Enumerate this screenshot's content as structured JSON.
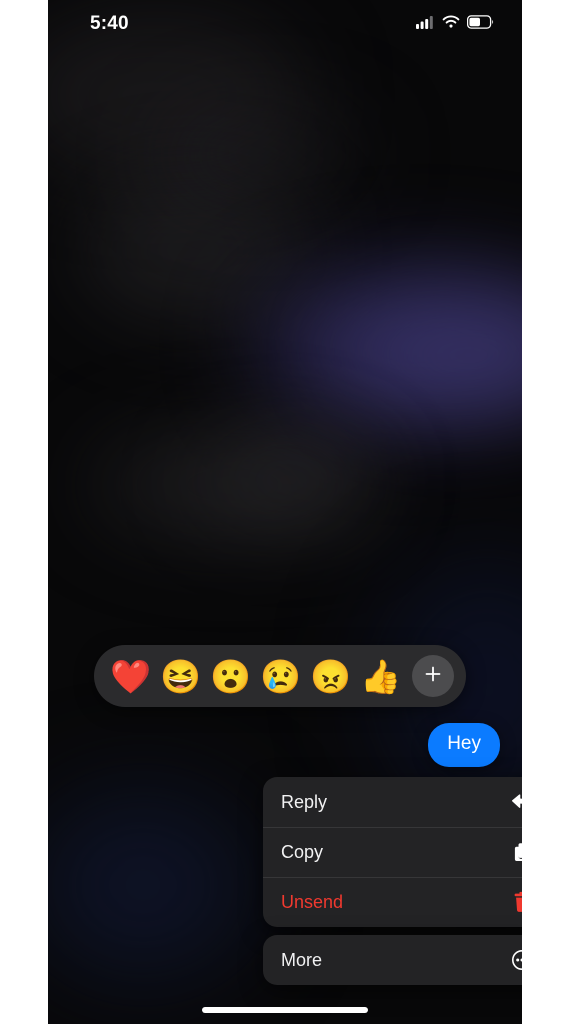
{
  "status_bar": {
    "time": "5:40",
    "cellular_icon": "cellular-signal-icon",
    "wifi_icon": "wifi-icon",
    "battery_icon": "battery-icon",
    "battery_level_percent": 55
  },
  "reaction_bar": {
    "reactions": [
      {
        "name": "heart",
        "glyph": "❤️"
      },
      {
        "name": "laughing",
        "glyph": "😆"
      },
      {
        "name": "surprised",
        "glyph": "😮"
      },
      {
        "name": "sad",
        "glyph": "😢"
      },
      {
        "name": "angry",
        "glyph": "😠"
      },
      {
        "name": "thumbs-up",
        "glyph": "👍"
      }
    ],
    "add_button": {
      "name": "add-reaction-button",
      "glyph": "+"
    }
  },
  "message": {
    "text": "Hey",
    "sender": "outgoing",
    "bubble_color": "#0b7bff"
  },
  "context_menu": {
    "groups": [
      {
        "items": [
          {
            "label": "Reply",
            "icon": "reply-arrow-icon",
            "destructive": false
          },
          {
            "label": "Copy",
            "icon": "copy-documents-icon",
            "destructive": false
          },
          {
            "label": "Unsend",
            "icon": "trash-icon",
            "destructive": true
          }
        ]
      },
      {
        "items": [
          {
            "label": "More",
            "icon": "ellipsis-circle-icon",
            "destructive": false
          }
        ]
      }
    ],
    "destructive_color": "#f0392f"
  },
  "home_indicator": {
    "name": "home-indicator"
  }
}
